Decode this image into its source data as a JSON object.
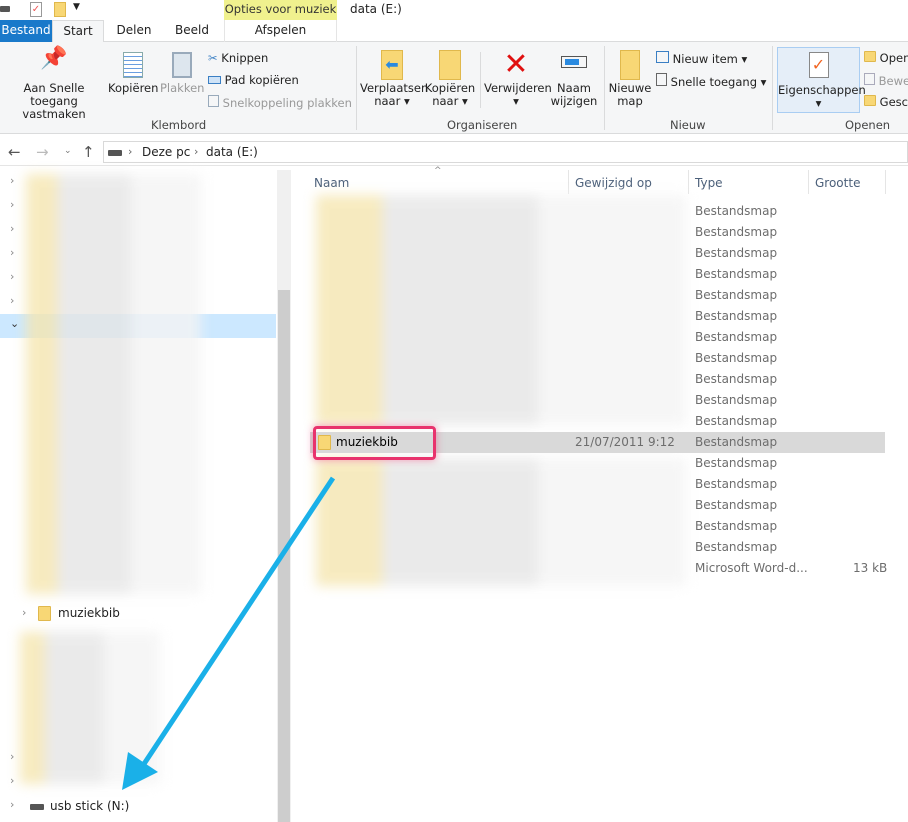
{
  "window": {
    "title": "data (E:)",
    "context_tab": "Opties voor muziek"
  },
  "tabs": [
    {
      "label": "Bestand",
      "active": false
    },
    {
      "label": "Start",
      "active": true
    },
    {
      "label": "Delen"
    },
    {
      "label": "Beeld"
    },
    {
      "label": "Afspelen"
    }
  ],
  "ribbon": {
    "klembord": {
      "label": "Klembord",
      "pin": "Aan Snelle toegang vastmaken",
      "pin1": "Aan Snelle toegang",
      "pin2": "vastmaken",
      "copy": "Kopiëren",
      "paste": "Plakken",
      "cut": "Knippen",
      "copy_path": "Pad kopiëren",
      "paste_shortcut": "Snelkoppeling plakken"
    },
    "organiseren": {
      "label": "Organiseren",
      "move1": "Verplaatsen",
      "move2": "naar",
      "copyto1": "Kopiëren",
      "copyto2": "naar",
      "delete": "Verwijderen",
      "rename1": "Naam",
      "rename2": "wijzigen"
    },
    "nieuw": {
      "label": "Nieuw",
      "newfolder1": "Nieuwe",
      "newfolder2": "map",
      "newitem": "Nieuw item",
      "easy": "Snelle toegang"
    },
    "openen": {
      "label": "Openen",
      "props": "Eigenschappen",
      "open": "Open",
      "edit": "Bewe",
      "history": "Gesc"
    }
  },
  "address": {
    "crumbs": [
      "Deze pc",
      "data (E:)"
    ]
  },
  "nav": {
    "folder": "muziekbib",
    "drive": "usb stick (N:)"
  },
  "columns": [
    "Naam",
    "Gewijzigd op",
    "Type",
    "Grootte"
  ],
  "rows": [
    {
      "name": "",
      "date": "",
      "type": "Bestandsmap",
      "size": ""
    },
    {
      "name": "",
      "date": "",
      "type": "Bestandsmap",
      "size": ""
    },
    {
      "name": "",
      "date": "",
      "type": "Bestandsmap",
      "size": ""
    },
    {
      "name": "",
      "date": "",
      "type": "Bestandsmap",
      "size": ""
    },
    {
      "name": "",
      "date": "",
      "type": "Bestandsmap",
      "size": ""
    },
    {
      "name": "",
      "date": "",
      "type": "Bestandsmap",
      "size": ""
    },
    {
      "name": "",
      "date": "",
      "type": "Bestandsmap",
      "size": ""
    },
    {
      "name": "",
      "date": "",
      "type": "Bestandsmap",
      "size": ""
    },
    {
      "name": "",
      "date": "",
      "type": "Bestandsmap",
      "size": ""
    },
    {
      "name": "",
      "date": "",
      "type": "Bestandsmap",
      "size": ""
    },
    {
      "name": "",
      "date": "",
      "type": "Bestandsmap",
      "size": ""
    },
    {
      "name": "muziekbib",
      "date": "21/07/2011 9:12",
      "type": "Bestandsmap",
      "size": "",
      "selected": true
    },
    {
      "name": "",
      "date": "",
      "type": "Bestandsmap",
      "size": ""
    },
    {
      "name": "",
      "date": "",
      "type": "Bestandsmap",
      "size": ""
    },
    {
      "name": "",
      "date": "",
      "type": "Bestandsmap",
      "size": ""
    },
    {
      "name": "",
      "date": "",
      "type": "Bestandsmap",
      "size": ""
    },
    {
      "name": "",
      "date": "",
      "type": "Bestandsmap",
      "size": ""
    },
    {
      "name": "",
      "date": "",
      "type": "Microsoft Word-d...",
      "size": "13 kB"
    }
  ],
  "colors": {
    "accent": "#1979ca",
    "highlight": "#e8336d",
    "arrow": "#1ab0e8",
    "selected_row": "#d9d9d9",
    "nav_selected": "#cce8ff"
  }
}
